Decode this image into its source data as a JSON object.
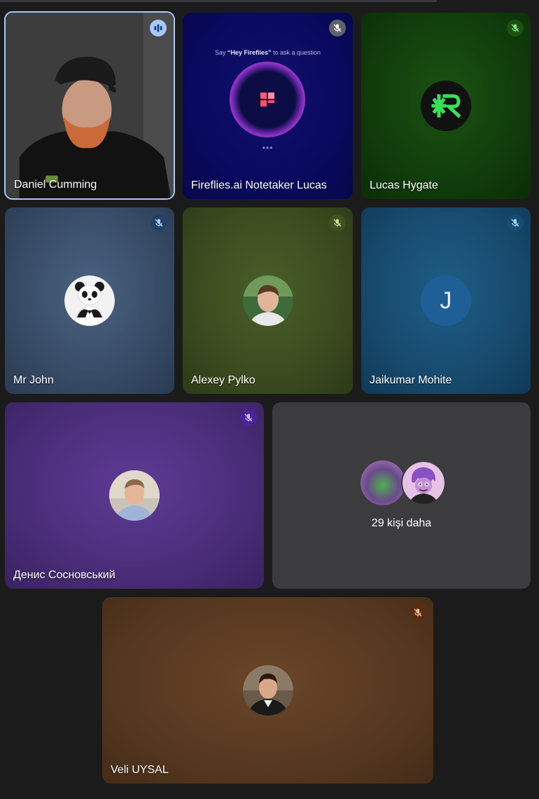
{
  "participants": [
    {
      "id": "daniel",
      "name": "Daniel Cumming",
      "mic": "speaking",
      "mic_bg": "#a8c7fa"
    },
    {
      "id": "fireflies",
      "name": "Fireflies.ai Notetaker Lucas",
      "mic": "muted",
      "mic_bg": "#5f6368",
      "prompt_before": "Say ",
      "prompt_hotword": "“Hey Fireflies”",
      "prompt_after": " to ask a question",
      "dots": "•••"
    },
    {
      "id": "lucas",
      "name": "Lucas Hygate",
      "mic": "muted",
      "mic_bg": "#1a5212"
    },
    {
      "id": "john",
      "name": "Mr John",
      "mic": "muted",
      "mic_bg": "#23406a"
    },
    {
      "id": "alexey",
      "name": "Alexey Pylko",
      "mic": "muted",
      "mic_bg": "#3e5220"
    },
    {
      "id": "jaikumar",
      "name": "Jaikumar Mohite",
      "mic": "muted",
      "mic_bg": "#154e74",
      "initial": "J"
    },
    {
      "id": "denis",
      "name": "Денис Сосновський",
      "mic": "muted",
      "mic_bg": "#4a2496"
    },
    {
      "id": "veli",
      "name": "Veli UYSAL",
      "mic": "muted",
      "mic_bg": "#5a2c10"
    }
  ],
  "more": {
    "label": "29 kişi daha"
  },
  "colors": {
    "active_border": "#a8c7fa",
    "background": "#1b1b1c"
  }
}
